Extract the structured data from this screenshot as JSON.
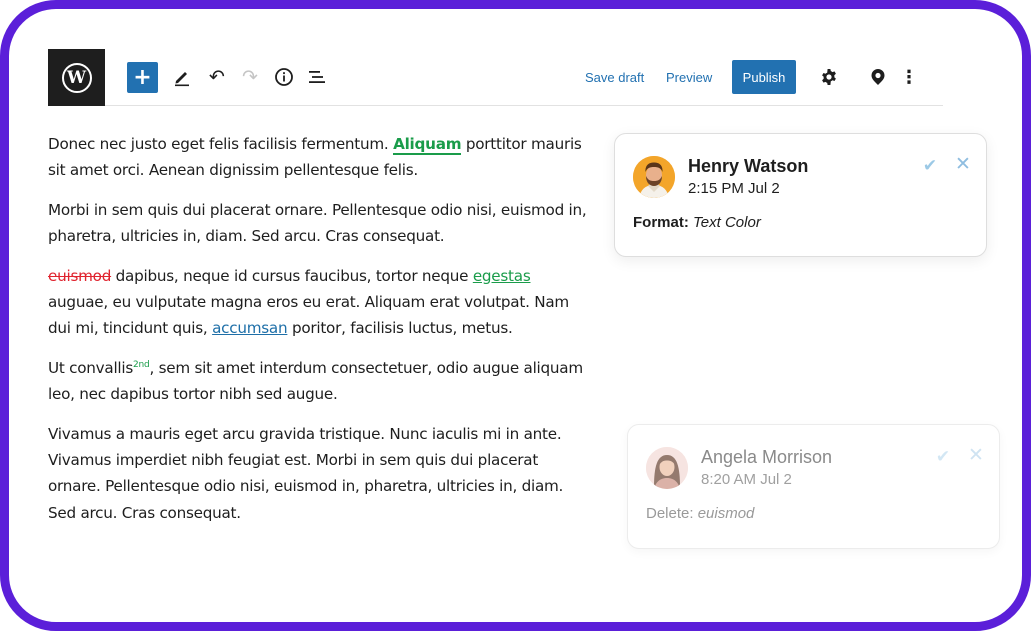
{
  "toolbar": {
    "logo_letter": "W",
    "add_label": "+",
    "undo_icon": "↶",
    "redo_icon": "↷",
    "save_draft": "Save draft",
    "preview": "Preview",
    "publish": "Publish",
    "more_icon": "⋮",
    "colors": {
      "accent": "#2271b1",
      "logo_bg": "#1e1e1e"
    }
  },
  "content": {
    "p1": {
      "a": "Donec nec justo eget felis facilisis fermentum. ",
      "highlight": "Aliquam",
      "b": " porttitor mauris sit amet orci. Aenean dignissim pellentesque felis."
    },
    "p2": {
      "text": "Morbi in sem quis dui placerat ornare. Pellentesque odio nisi, euismod in, pharetra, ultricies in, diam. Sed arcu. Cras consequat."
    },
    "p3": {
      "strike": "euismod",
      "a": " dapibus, neque id cursus faucibus, tortor neque ",
      "link_green": "egestas",
      "b": " auguae, eu vulputate magna eros eu erat. Aliquam erat volutpat. Nam dui mi, tincidunt quis, ",
      "link_blue": "accumsan",
      "c": " poritor, facilisis luctus, metus."
    },
    "p4": {
      "a": "Ut convallis",
      "sup": "2nd",
      "b": ", sem sit amet interdum consectetuer, odio augue aliquam leo, nec dapibus tortor nibh sed augue."
    },
    "p5": {
      "text": "Vivamus a mauris eget arcu gravida tristique. Nunc iaculis mi in ante. Vivamus imperdiet nibh feugiat est. Morbi in sem quis dui placerat ornare. Pellentesque odio nisi, euismod in, pharetra, ultricies in, diam. Sed arcu. Cras consequat."
    },
    "colors": {
      "insert": "#1a9c4a",
      "delete": "#e0242f",
      "link": "#1e6fa8"
    }
  },
  "comments": [
    {
      "name": "Henry Watson",
      "time": "2:15 PM Jul 2",
      "action_label": "Format:",
      "action_value": "Text Color",
      "check_icon": "✔",
      "close_icon": "✕"
    },
    {
      "name": "Angela Morrison",
      "time": "8:20 AM Jul 2",
      "action_label": "Delete:",
      "action_value": "euismod",
      "check_icon": "✔",
      "close_icon": "✕"
    }
  ],
  "frame_color": "#5b1fd9"
}
